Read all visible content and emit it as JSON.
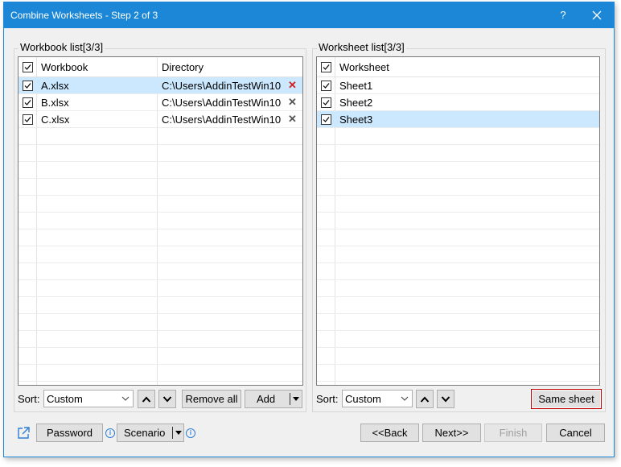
{
  "window": {
    "title": "Combine Worksheets - Step 2 of 3",
    "help_label": "?"
  },
  "workbook_panel": {
    "label": "Workbook list[3/3]",
    "columns": [
      "Workbook",
      "Directory"
    ],
    "rows": [
      {
        "name": "A.xlsx",
        "directory": "C:\\Users\\AddinTestWin10",
        "checked": true,
        "selected": true
      },
      {
        "name": "B.xlsx",
        "directory": "C:\\Users\\AddinTestWin10",
        "checked": true,
        "selected": false
      },
      {
        "name": "C.xlsx",
        "directory": "C:\\Users\\AddinTestWin10",
        "checked": true,
        "selected": false
      }
    ],
    "sort_label": "Sort:",
    "sort_value": "Custom",
    "remove_all_label": "Remove all",
    "add_label": "Add"
  },
  "worksheet_panel": {
    "label": "Worksheet list[3/3]",
    "columns": [
      "Worksheet"
    ],
    "rows": [
      {
        "name": "Sheet1",
        "checked": true,
        "selected": false
      },
      {
        "name": "Sheet2",
        "checked": true,
        "selected": false
      },
      {
        "name": "Sheet3",
        "checked": true,
        "selected": true
      }
    ],
    "sort_label": "Sort:",
    "sort_value": "Custom",
    "same_sheet_label": "Same sheet"
  },
  "footer": {
    "password_label": "Password",
    "scenario_label": "Scenario",
    "back_label": "<<Back",
    "next_label": "Next>>",
    "finish_label": "Finish",
    "cancel_label": "Cancel"
  },
  "colors": {
    "titlebar": "#1c87d6",
    "selection": "#cce8ff",
    "remove_red": "#d02020"
  },
  "icons": [
    "close-icon",
    "checkbox-icon",
    "remove-x-icon",
    "chevron-up-icon",
    "chevron-down-icon",
    "open-link-icon",
    "info-icon"
  ]
}
